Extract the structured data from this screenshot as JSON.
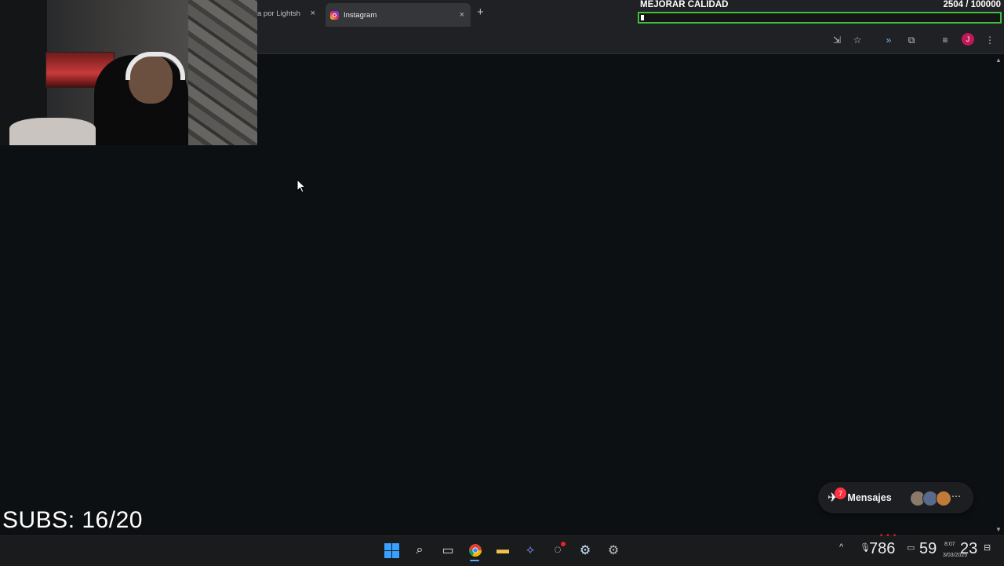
{
  "browser": {
    "tabs": [
      {
        "label": "a por Lightsh"
      },
      {
        "label": "Instagram"
      }
    ],
    "new_tab_symbol": "+",
    "close_symbol": "×",
    "profile_initial": "J",
    "icons": [
      "install-app-icon",
      "star-icon",
      "cast-icon",
      "extensions-icon",
      "media-control-icon",
      "menu-icon"
    ]
  },
  "goal": {
    "title": "MEJORAR CALIDAD",
    "current": 2504,
    "target": 100000,
    "count_text": "2504  / 100000",
    "progress_fraction": 0.025,
    "bar_color": "#3fbf3f"
  },
  "subs": {
    "text": "SUBS: 16/20"
  },
  "messages": {
    "label": "Mensajes",
    "badge": "7"
  },
  "taskbar": {
    "icons": [
      "windows-start-icon",
      "search-icon",
      "task-view-icon",
      "chrome-icon",
      "file-explorer-icon",
      "app-icon",
      "recording-app-icon",
      "steam-icon",
      "settings-icon"
    ],
    "tray": {
      "counter1": "786",
      "counter2": "59",
      "counter3": "23",
      "time": "8:07",
      "date": "3/03/2025"
    }
  }
}
